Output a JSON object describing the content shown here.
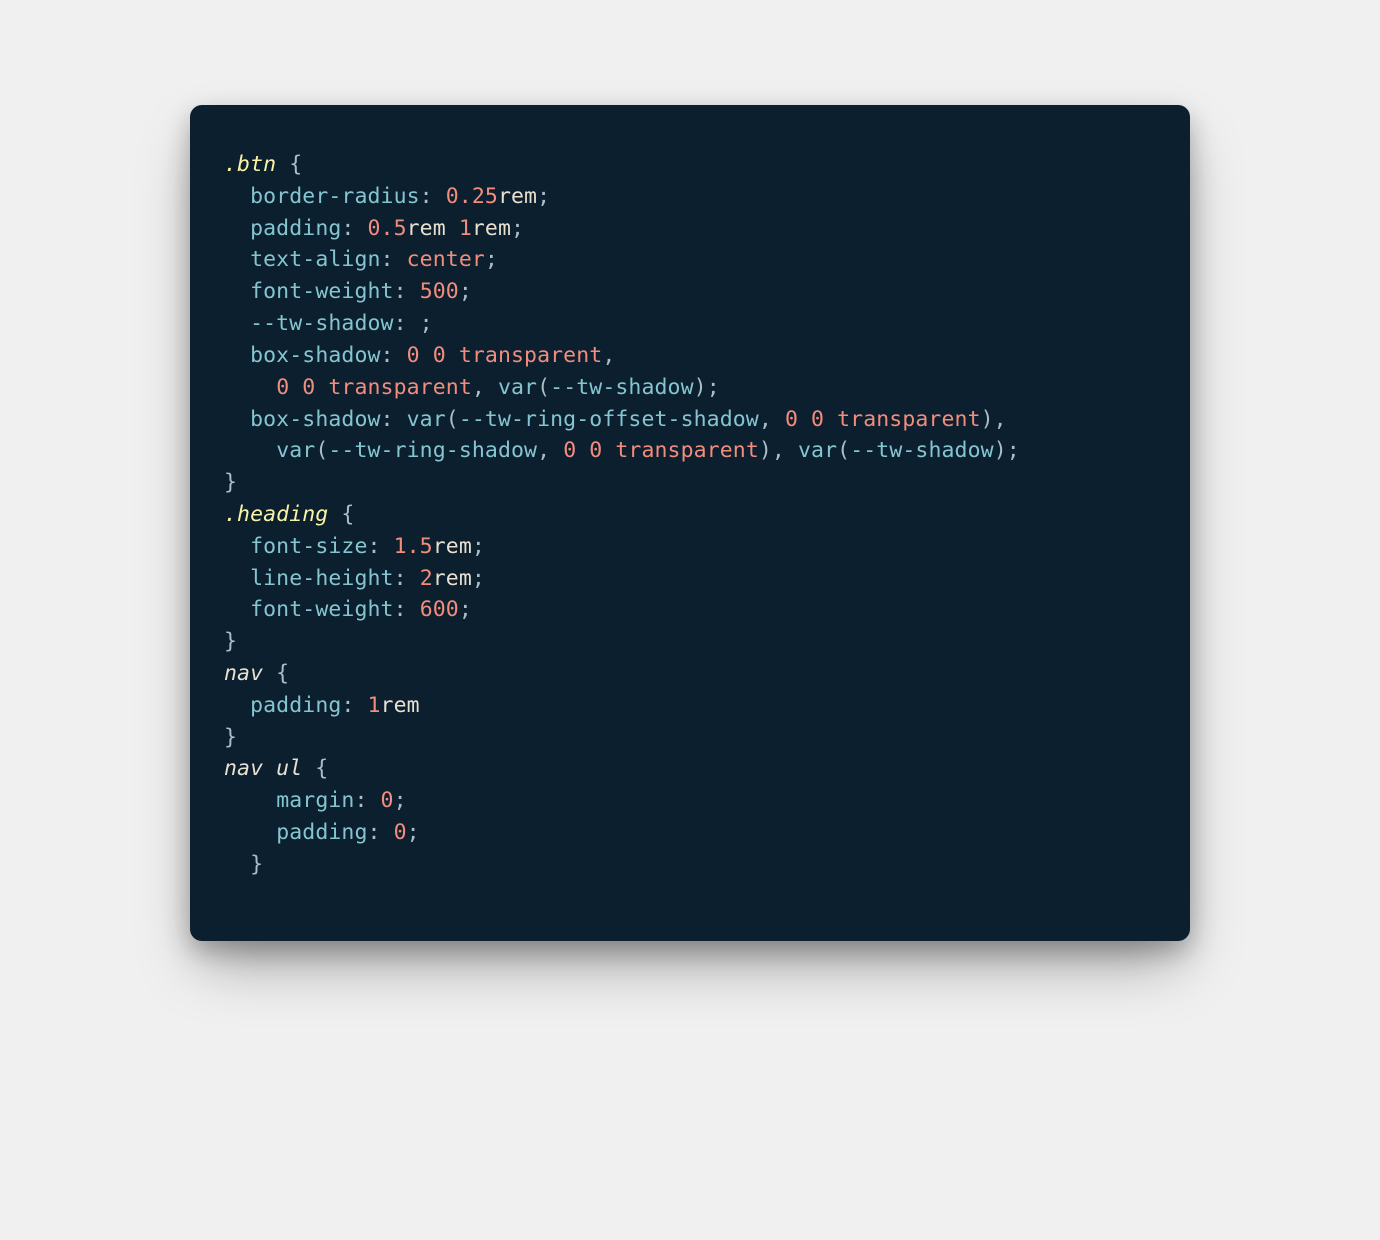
{
  "code": {
    "tokens": [
      [
        [
          "selector",
          ".btn"
        ],
        [
          "punct",
          " {"
        ]
      ],
      [
        [
          "punct",
          "  "
        ],
        [
          "prop",
          "border-radius"
        ],
        [
          "punct",
          ": "
        ],
        [
          "num",
          "0.25"
        ],
        [
          "unit",
          "rem"
        ],
        [
          "punct",
          ";"
        ]
      ],
      [
        [
          "punct",
          "  "
        ],
        [
          "prop",
          "padding"
        ],
        [
          "punct",
          ": "
        ],
        [
          "num",
          "0.5"
        ],
        [
          "unit",
          "rem "
        ],
        [
          "num",
          "1"
        ],
        [
          "unit",
          "rem"
        ],
        [
          "punct",
          ";"
        ]
      ],
      [
        [
          "punct",
          "  "
        ],
        [
          "prop",
          "text-align"
        ],
        [
          "punct",
          ": "
        ],
        [
          "value",
          "center"
        ],
        [
          "punct",
          ";"
        ]
      ],
      [
        [
          "punct",
          "  "
        ],
        [
          "prop",
          "font-weight"
        ],
        [
          "punct",
          ": "
        ],
        [
          "num",
          "500"
        ],
        [
          "punct",
          ";"
        ]
      ],
      [
        [
          "punct",
          "  "
        ],
        [
          "prop",
          "--tw-shadow"
        ],
        [
          "punct",
          ": ;"
        ]
      ],
      [
        [
          "punct",
          "  "
        ],
        [
          "prop",
          "box-shadow"
        ],
        [
          "punct",
          ": "
        ],
        [
          "num",
          "0 0"
        ],
        [
          "punct",
          " "
        ],
        [
          "value",
          "transparent"
        ],
        [
          "punct",
          ","
        ]
      ],
      [
        [
          "punct",
          "    "
        ],
        [
          "num",
          "0 0"
        ],
        [
          "punct",
          " "
        ],
        [
          "value",
          "transparent"
        ],
        [
          "punct",
          ", "
        ],
        [
          "func",
          "var"
        ],
        [
          "punct",
          "("
        ],
        [
          "varname",
          "--tw-shadow"
        ],
        [
          "punct",
          ");"
        ]
      ],
      [
        [
          "punct",
          "  "
        ],
        [
          "prop",
          "box-shadow"
        ],
        [
          "punct",
          ": "
        ],
        [
          "func",
          "var"
        ],
        [
          "punct",
          "("
        ],
        [
          "varname",
          "--tw-ring-offset-shadow"
        ],
        [
          "punct",
          ", "
        ],
        [
          "num",
          "0 0"
        ],
        [
          "punct",
          " "
        ],
        [
          "value",
          "transparent"
        ],
        [
          "punct",
          "),"
        ]
      ],
      [
        [
          "punct",
          "    "
        ],
        [
          "func",
          "var"
        ],
        [
          "punct",
          "("
        ],
        [
          "varname",
          "--tw-ring-shadow"
        ],
        [
          "punct",
          ", "
        ],
        [
          "num",
          "0 0"
        ],
        [
          "punct",
          " "
        ],
        [
          "value",
          "transparent"
        ],
        [
          "punct",
          "), "
        ],
        [
          "func",
          "var"
        ],
        [
          "punct",
          "("
        ],
        [
          "varname",
          "--tw-shadow"
        ],
        [
          "punct",
          ");"
        ]
      ],
      [
        [
          "punct",
          "}"
        ]
      ],
      [
        [
          "selector",
          ".heading"
        ],
        [
          "punct",
          " {"
        ]
      ],
      [
        [
          "punct",
          "  "
        ],
        [
          "prop",
          "font-size"
        ],
        [
          "punct",
          ": "
        ],
        [
          "num",
          "1.5"
        ],
        [
          "unit",
          "rem"
        ],
        [
          "punct",
          ";"
        ]
      ],
      [
        [
          "punct",
          "  "
        ],
        [
          "prop",
          "line-height"
        ],
        [
          "punct",
          ": "
        ],
        [
          "num",
          "2"
        ],
        [
          "unit",
          "rem"
        ],
        [
          "punct",
          ";"
        ]
      ],
      [
        [
          "punct",
          "  "
        ],
        [
          "prop",
          "font-weight"
        ],
        [
          "punct",
          ": "
        ],
        [
          "num",
          "600"
        ],
        [
          "punct",
          ";"
        ]
      ],
      [
        [
          "punct",
          "}"
        ]
      ],
      [
        [
          "tag",
          "nav"
        ],
        [
          "punct",
          " {"
        ]
      ],
      [
        [
          "punct",
          "  "
        ],
        [
          "prop",
          "padding"
        ],
        [
          "punct",
          ": "
        ],
        [
          "num",
          "1"
        ],
        [
          "unit",
          "rem"
        ]
      ],
      [
        [
          "punct",
          "}"
        ]
      ],
      [
        [
          "tag",
          "nav ul"
        ],
        [
          "punct",
          " {"
        ]
      ],
      [
        [
          "punct",
          "    "
        ],
        [
          "prop",
          "margin"
        ],
        [
          "punct",
          ": "
        ],
        [
          "num",
          "0"
        ],
        [
          "punct",
          ";"
        ]
      ],
      [
        [
          "punct",
          "    "
        ],
        [
          "prop",
          "padding"
        ],
        [
          "punct",
          ": "
        ],
        [
          "num",
          "0"
        ],
        [
          "punct",
          ";"
        ]
      ],
      [
        [
          "punct",
          "  }"
        ]
      ]
    ]
  },
  "colors": {
    "background": "#0b1f2e",
    "selector": "#f9f3a5",
    "tag": "#e8e0d0",
    "prop": "#85c5d1",
    "num": "#f28c7d",
    "unit": "#e8e0d0",
    "value": "#f28c7d",
    "punct": "#a8bec9"
  }
}
